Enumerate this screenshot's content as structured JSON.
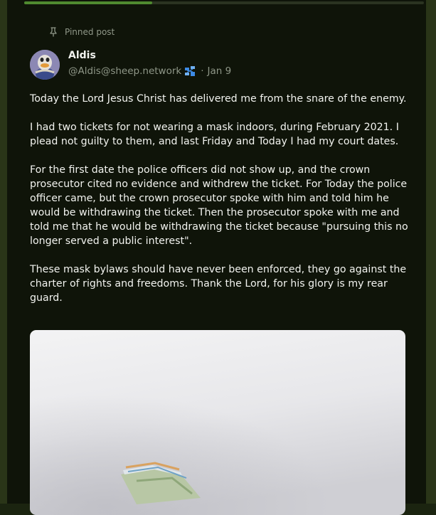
{
  "progress": 0.32,
  "post": {
    "pinned_label": "Pinned post",
    "author": {
      "name": "Aldis",
      "handle": "@Aldis@sheep.network"
    },
    "date_sep": "·",
    "date": "Jan 9",
    "paragraphs": [
      "Today the Lord Jesus Christ has delivered me from the snare of the enemy.",
      "I had two tickets for not wearing a mask indoors, during February 2021. I plead not guilty to them, and last Friday and Today I had my court dates.",
      "For the first date the police officers did not show up, and the crown prosecutor cited no evidence and withdrew the ticket. For Today the police officer came, but the crown prosecutor spoke with him and told him he would be withdrawing the ticket. Then the prosecutor spoke with me and told me that he would be withdrawing the ticket because \"pursuing this no longer served a public interest\".",
      "These mask bylaws should have never been enforced, they go against the charter of rights and freedoms. Thank the Lord, for his glory is my rear guard."
    ]
  },
  "colors": {
    "card_bg": "#0f1409",
    "page_bg": "#1b2410",
    "accent": "#4f8a2f",
    "text": "#f2f3ef",
    "muted": "#8f9788",
    "federation_icon": "#3d8be6"
  },
  "icons": {
    "pin": "pin-icon",
    "federation": "federation-icon"
  }
}
